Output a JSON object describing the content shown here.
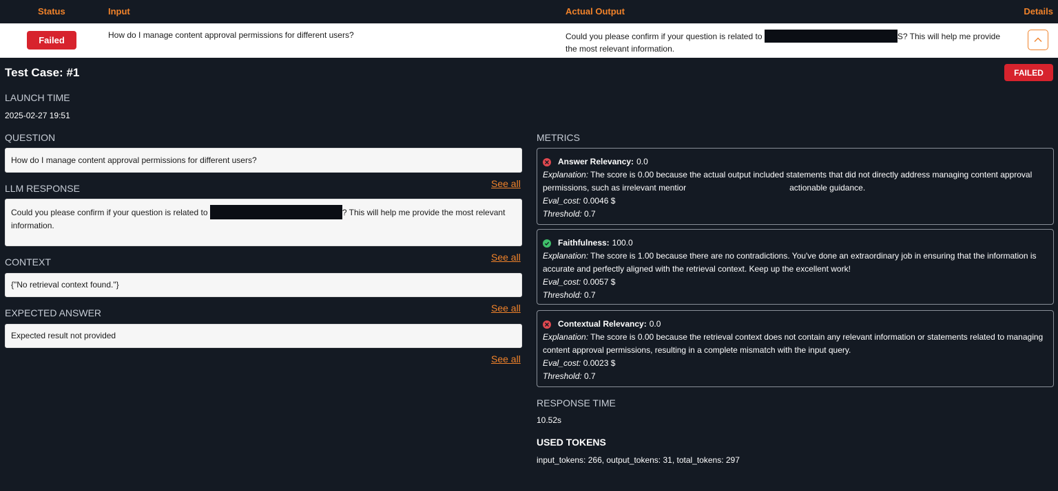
{
  "table_header": {
    "status": "Status",
    "input": "Input",
    "actual_output": "Actual Output",
    "details": "Details"
  },
  "row": {
    "status": "Failed",
    "input": "How do I manage content approval permissions for different users?",
    "output_before": "Could you please confirm if your question is related to",
    "output_after": "S? This will help me provide the most relevant information."
  },
  "test_case": {
    "title": "Test Case: #1",
    "status_pill": "FAILED",
    "launch_time_label": "LAUNCH TIME",
    "launch_time": "2025-02-27 19:51",
    "question_label": "QUESTION",
    "question": "How do I manage content approval permissions for different users?",
    "llm_response_label": "LLM RESPONSE",
    "llm_response_before": "Could you please confirm if your question is related to",
    "llm_response_after": "? This will help me provide the most relevant information.",
    "context_label": "CONTEXT",
    "context": "{\"No retrieval context found.\"}",
    "expected_answer_label": "EXPECTED ANSWER",
    "expected_answer": "Expected result not provided",
    "see_all": "See all"
  },
  "metrics": {
    "label": "METRICS",
    "explanation_key": "Explanation:",
    "eval_cost_key": "Eval_cost:",
    "threshold_key": "Threshold:",
    "items": [
      {
        "name": "Answer Relevancy:",
        "score": "0.0",
        "passed": false,
        "explanation_a": "The score is 0.00 because the actual output included statements that did not directly address managing content approval permissions, such as irrelevant mentior",
        "explanation_b": "actionable guidance.",
        "eval_cost": "0.0046 $",
        "threshold": "0.7"
      },
      {
        "name": "Faithfulness:",
        "score": "100.0",
        "passed": true,
        "explanation_a": "The score is 1.00 because there are no contradictions. You've done an extraordinary job in ensuring that the information is accurate and perfectly aligned with the retrieval context. Keep up the excellent work!",
        "eval_cost": "0.0057 $",
        "threshold": "0.7"
      },
      {
        "name": "Contextual Relevancy:",
        "score": "0.0",
        "passed": false,
        "explanation_a": "The score is 0.00 because the retrieval context does not contain any relevant information or statements related to managing content approval permissions, resulting in a complete mismatch with the input query.",
        "eval_cost": "0.0023 $",
        "threshold": "0.7"
      }
    ]
  },
  "response_time": {
    "label": "RESPONSE TIME",
    "value": "10.52s"
  },
  "used_tokens": {
    "label": "USED TOKENS",
    "value": "input_tokens: 266, output_tokens: 31, total_tokens: 297"
  },
  "colors": {
    "background": "#141a23",
    "accent": "#f0822a",
    "failed": "#d7232d",
    "pass": "#3fbf6a"
  }
}
